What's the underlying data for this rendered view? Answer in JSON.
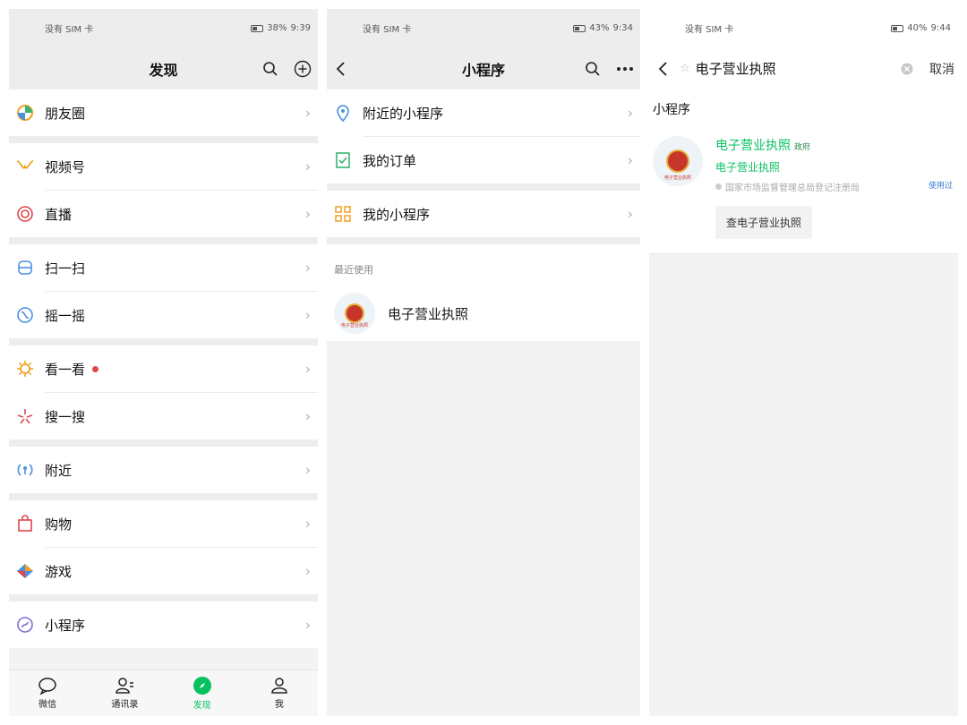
{
  "colors": {
    "accent": "#07c160",
    "badge": "#e0454b",
    "used_link": "#3b7bd4"
  },
  "screen1": {
    "status": {
      "left": "没有 SIM 卡",
      "battery": "38%",
      "time": "9:39"
    },
    "title": "发现",
    "items": [
      {
        "label": "朋友圈",
        "icon": "moments-icon"
      },
      {
        "label": "视频号",
        "icon": "channels-icon"
      },
      {
        "label": "直播",
        "icon": "live-icon"
      },
      {
        "label": "扫一扫",
        "icon": "scan-icon"
      },
      {
        "label": "摇一摇",
        "icon": "shake-icon"
      },
      {
        "label": "看一看",
        "icon": "top-stories-icon"
      },
      {
        "label": "搜一搜",
        "icon": "search-star-icon"
      },
      {
        "label": "附近",
        "icon": "nearby-icon"
      },
      {
        "label": "购物",
        "icon": "shopping-icon"
      },
      {
        "label": "游戏",
        "icon": "games-icon"
      },
      {
        "label": "小程序",
        "icon": "mini-program-icon"
      }
    ],
    "tabs": [
      {
        "label": "微信",
        "icon": "chat-icon"
      },
      {
        "label": "通讯录",
        "icon": "contacts-icon"
      },
      {
        "label": "发现",
        "icon": "compass-icon",
        "active": true
      },
      {
        "label": "我",
        "icon": "me-icon"
      }
    ]
  },
  "screen2": {
    "status": {
      "left": "没有 SIM 卡",
      "battery": "43%",
      "time": "9:34"
    },
    "title": "小程序",
    "items": [
      {
        "label": "附近的小程序",
        "icon": "location-pin-icon"
      },
      {
        "label": "我的订单",
        "icon": "order-icon"
      },
      {
        "label": "我的小程序",
        "icon": "grid-icon"
      }
    ],
    "recent_header": "最近使用",
    "recent": [
      {
        "name": "电子营业执照",
        "avatar_caption": "电子营业执照"
      }
    ]
  },
  "screen3": {
    "status": {
      "left": "没有 SIM 卡",
      "battery": "40%",
      "time": "9:44"
    },
    "query": "电子营业执照",
    "cancel": "取消",
    "section": "小程序",
    "result": {
      "name": "电子营业执照",
      "tag": "政府",
      "subtitle": "电子营业执照",
      "org": "国家市场监督管理总局登记注册局",
      "used": "使用过",
      "action": "查电子营业执照",
      "avatar_caption": "电子营业执照"
    }
  }
}
